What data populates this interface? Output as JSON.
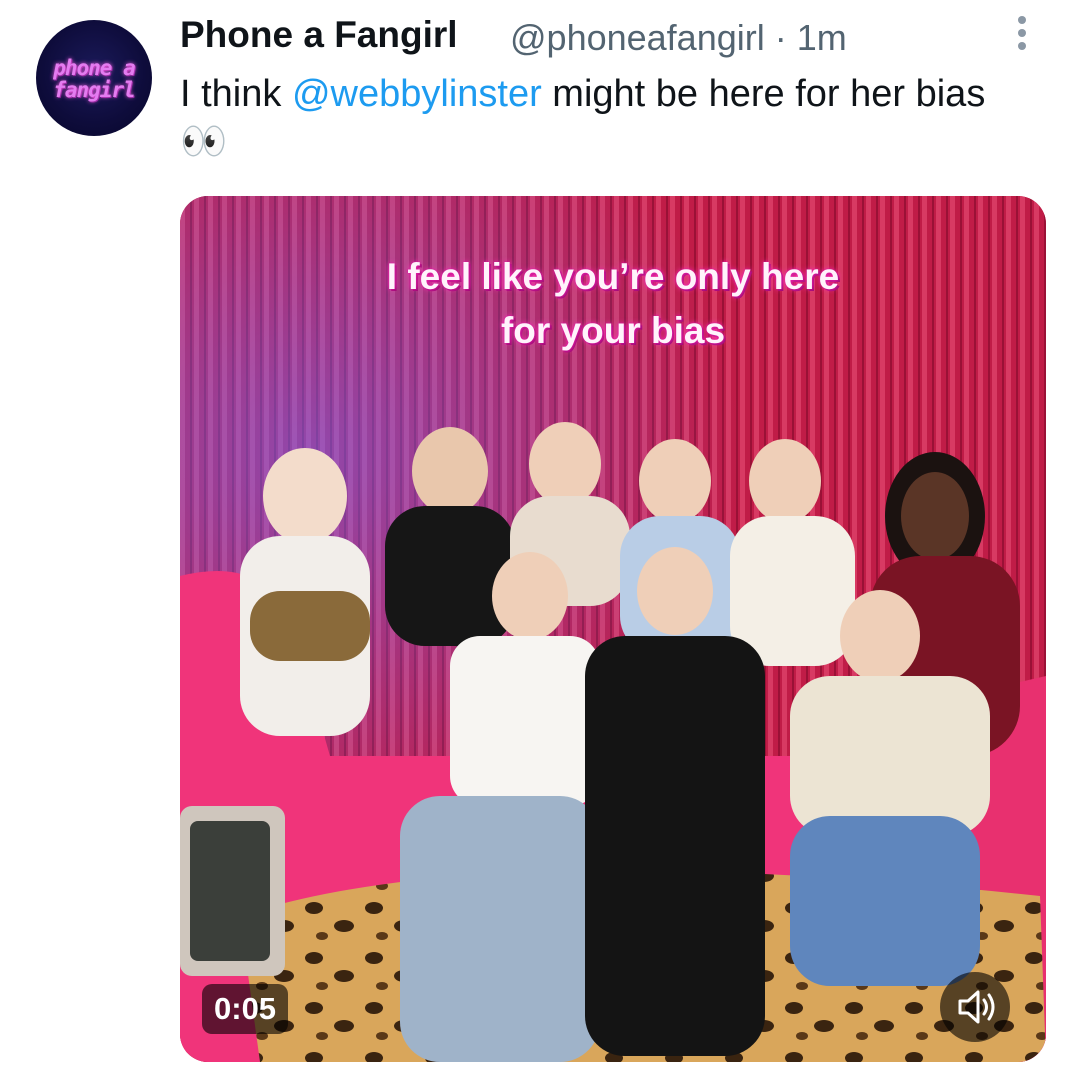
{
  "tweet": {
    "author_name": "Phone a Fangirl",
    "meta": "@phoneafangirl · 1m",
    "avatar_text_line1": "phone a",
    "avatar_text_line2": "fangirl",
    "text_before": "I think ",
    "mention": "@webbylinster",
    "text_after": " might be here for her bias 👀"
  },
  "video": {
    "caption_line1": "I feel like you’re only here",
    "caption_line2": "for your bias",
    "timestamp": "0:05"
  },
  "icons": {
    "more": "more-vertical-icon",
    "sound": "speaker-icon"
  },
  "colors": {
    "mention": "#1d9bf0",
    "meta": "#536471",
    "curtain": "#c11d48"
  }
}
